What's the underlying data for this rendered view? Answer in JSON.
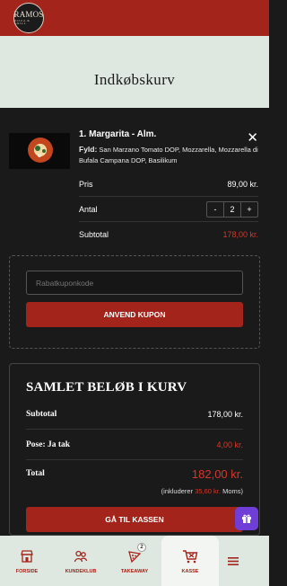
{
  "brand": {
    "logo_text": "RAMOS",
    "logo_sub": "PIZZA & GRILL"
  },
  "page": {
    "title": "Indkøbskurv"
  },
  "cart_item": {
    "name": "1. Margarita - Alm.",
    "filling_label": "Fyld:",
    "filling": "San Marzano Tomato DOP, Mozzarella, Mozzarella di Bufala Campana DOP, Basilikum",
    "price_label": "Pris",
    "price": "89,00 kr.",
    "qty_label": "Antal",
    "qty": "2",
    "subtotal_label": "Subtotal",
    "subtotal": "178,00 kr."
  },
  "coupon": {
    "placeholder": "Rabatkuponkode",
    "button": "ANVEND KUPON"
  },
  "summary": {
    "title": "SAMLET BELØB I KURV",
    "subtotal_label": "Subtotal",
    "subtotal": "178,00 kr.",
    "bag_label": "Pose: Ja tak",
    "bag": "4,00 kr.",
    "total_label": "Total",
    "total": "182,00 kr.",
    "vat_prefix": "(inkluderer",
    "vat_amount": "35,60 kr.",
    "vat_suffix": "Moms)",
    "checkout": "GÅ TIL KASSEN"
  },
  "nav": {
    "items": [
      {
        "label": "FORSIDE",
        "icon": "store-icon"
      },
      {
        "label": "KUNDEKLUB",
        "icon": "people-icon"
      },
      {
        "label": "TAKEAWAY",
        "icon": "pizza-slice-icon",
        "badge": "2"
      },
      {
        "label": "KASSE",
        "icon": "cart-icon"
      }
    ]
  },
  "colors": {
    "brand_red": "#a3241a",
    "accent_red": "#d5372a",
    "gift_purple": "#6f3ed6",
    "cream": "#dfe8e0"
  }
}
